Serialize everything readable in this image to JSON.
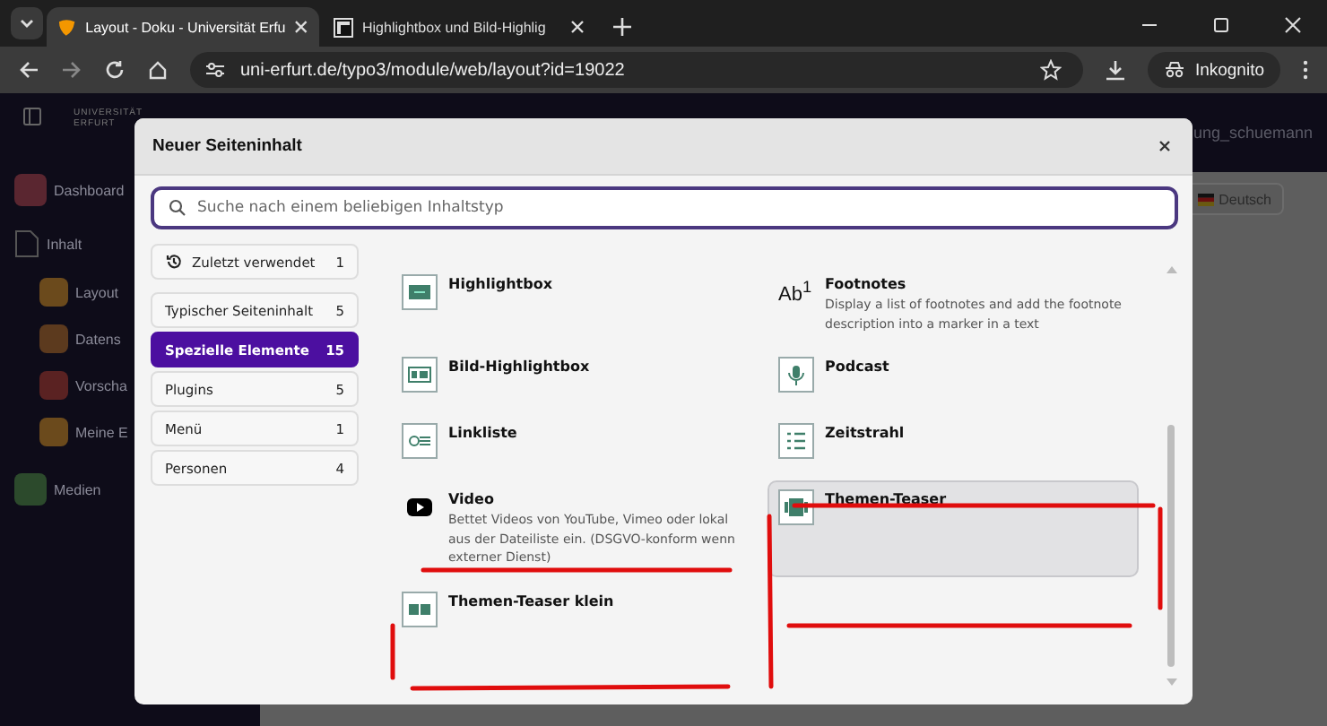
{
  "browser": {
    "tabs": [
      {
        "title": "Layout - Doku - Universität Erfu",
        "selected": true
      },
      {
        "title": "Highlightbox und Bild-Highlig",
        "selected": false
      }
    ],
    "url": "uni-erfurt.de/typo3/module/web/layout?id=19022",
    "profile": "Inkognito"
  },
  "backdrop": {
    "logo": "UNIVERSITÄT ERFURT",
    "user": "ung_schuemann",
    "language": "Deutsch",
    "sidebar": [
      {
        "label": "Dashboard",
        "kind": "main",
        "color": "#5a2630"
      },
      {
        "label": "Inhalt",
        "kind": "page"
      },
      {
        "label": "Layout",
        "kind": "sub",
        "color": "#6b4a1c"
      },
      {
        "label": "Datens",
        "kind": "sub",
        "color": "#5c3a1e"
      },
      {
        "label": "Vorscha",
        "kind": "sub",
        "color": "#5a2222"
      },
      {
        "label": "Meine E",
        "kind": "sub",
        "color": "#6b4a1c"
      },
      {
        "label": "Medien",
        "kind": "main",
        "color": "#2c4a2c"
      }
    ]
  },
  "modal": {
    "title": "Neuer Seiteninhalt",
    "search": {
      "placeholder": "Suche nach einem beliebigen Inhaltstyp"
    },
    "categories": [
      {
        "label": "Zuletzt verwendet",
        "count": "1",
        "kind": "recent",
        "selected": false
      },
      {
        "label": "Typischer Seiteninhalt",
        "count": "5",
        "kind": "plain",
        "selected": false
      },
      {
        "label": "Spezielle Elemente",
        "count": "15",
        "kind": "plain",
        "selected": true
      },
      {
        "label": "Plugins",
        "count": "5",
        "kind": "plain",
        "selected": false
      },
      {
        "label": "Menü",
        "count": "1",
        "kind": "plain",
        "selected": false
      },
      {
        "label": "Personen",
        "count": "4",
        "kind": "plain",
        "selected": false
      }
    ],
    "items": [
      {
        "title": "Highlightbox",
        "kind": "highlightbox",
        "selected": false
      },
      {
        "title": "Footnotes",
        "kind": "footnotes",
        "icon_text": "Ab$^{1}$",
        "description": "Display a list of footnotes and add the footnote description into a marker in a text",
        "selected": false
      },
      {
        "title": "Bild-Highlightbox",
        "kind": "image-box",
        "selected": false
      },
      {
        "title": "Podcast",
        "kind": "podcast",
        "selected": false
      },
      {
        "title": "Linkliste",
        "kind": "linklist",
        "selected": false
      },
      {
        "title": "Zeitstrahl",
        "kind": "timeline",
        "selected": false
      },
      {
        "title": "Video",
        "kind": "video",
        "description": "Bettet Videos von YouTube, Vimeo oder lokal aus der Dateiliste ein. (DSGVO-konform wenn externer Dienst)",
        "selected": false
      },
      {
        "title": "Themen-Teaser",
        "kind": "teaser",
        "selected": true
      },
      {
        "title": "Themen-Teaser klein",
        "kind": "teaser-small",
        "selected": false
      }
    ]
  }
}
